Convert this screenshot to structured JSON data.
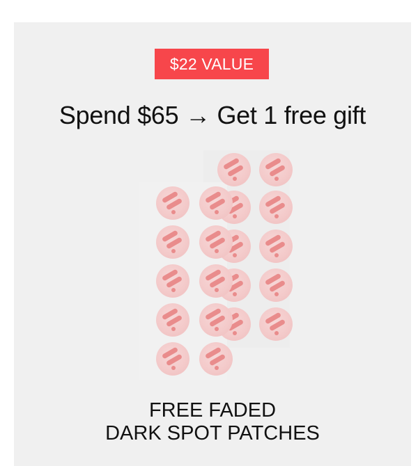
{
  "promo": {
    "badge": "$22 VALUE",
    "headline": "Spend $65 → Get 1 free gift",
    "product_line1": "FREE FADED",
    "product_line2": "DARK SPOT PATCHES"
  },
  "colors": {
    "badge_bg": "#f7464b",
    "card_bg": "#f0f0f0",
    "patch": "#f3c9c9",
    "patch_mark": "#e98c8c"
  },
  "image": {
    "name": "dark-spot-patch-sheets",
    "description_alt": ""
  }
}
